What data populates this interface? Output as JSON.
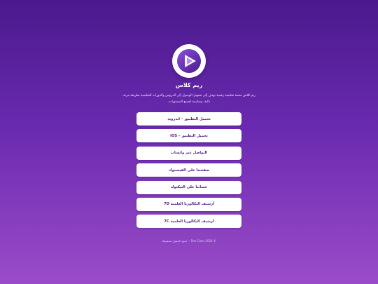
{
  "brand": {
    "name": "ريم كلاس",
    "description": "ريم كلاس منصة تعليمية رقمية تهدف إلى تسهيل الوصول إلى الدروس والدورات التعليمية بطريقة مرنة، ذكية، ومناسبة لجميع المستويات.",
    "logo_icon": "play-icon",
    "colors": {
      "accent": "#4a1a8c",
      "logo_inner": "#6a2ab0"
    }
  },
  "links": [
    {
      "label": "تحميل التطبيق – اندرويد"
    },
    {
      "label": "تحميل التطبيق – iOS"
    },
    {
      "label": "التواصل عبر واتساب"
    },
    {
      "label": "صفحتنا على الفيسبوك"
    },
    {
      "label": "حسابنا على التيكتوك"
    },
    {
      "label": "أرشيف البكالوريا العلمية 7D"
    },
    {
      "label": "أرشيف البكالوريا العلمية 7C"
    }
  ],
  "footer": {
    "text": "© Rim Class 2026 – جميع الحقوق محفوظة"
  }
}
